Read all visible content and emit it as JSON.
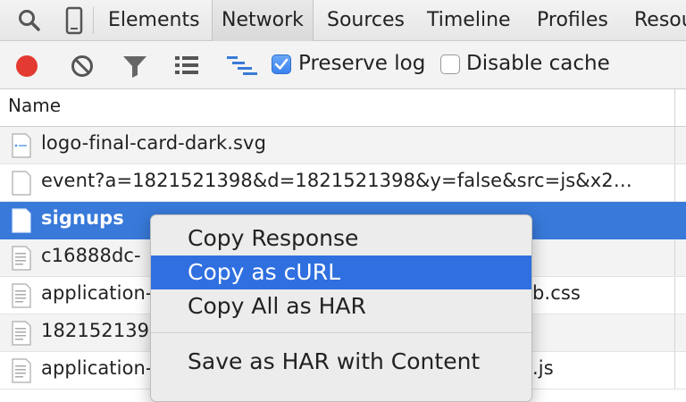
{
  "tabs": [
    "Elements",
    "Network",
    "Sources",
    "Timeline",
    "Profiles",
    "Resou"
  ],
  "active_tab": "Network",
  "toolbar": {
    "preserve_log_label": "Preserve log",
    "preserve_log_checked": true,
    "disable_cache_label": "Disable cache",
    "disable_cache_checked": false,
    "icons": [
      "record-icon",
      "clear-icon",
      "filter-icon",
      "list-view-icon",
      "waterfall-icon"
    ]
  },
  "table": {
    "column_header": "Name",
    "rows": [
      {
        "name": "logo-final-card-dark.svg",
        "icon": "svg-file-icon"
      },
      {
        "name": "event?a=1821521398&d=1821521398&y=false&src=js&x2…",
        "icon": "document-icon"
      },
      {
        "name": "signups",
        "icon": "document-icon",
        "selected": true
      },
      {
        "name": "c16888dc-",
        "icon": "text-file-icon"
      },
      {
        "name": "application-",
        "suffix": "b.css",
        "icon": "text-file-icon"
      },
      {
        "name": "182152139",
        "icon": "text-file-icon"
      },
      {
        "name": "application-",
        "suffix": ".js",
        "icon": "text-file-icon"
      }
    ]
  },
  "context_menu": {
    "items": [
      "Copy Response",
      "Copy as cURL",
      "Copy All as HAR",
      "Save as HAR with Content"
    ],
    "highlighted": "Copy as cURL"
  },
  "colors": {
    "selection": "#3879d9",
    "menu_highlight": "#2f6fe0",
    "record_red": "#e33a32",
    "checkbox_blue": "#3a82ee"
  }
}
